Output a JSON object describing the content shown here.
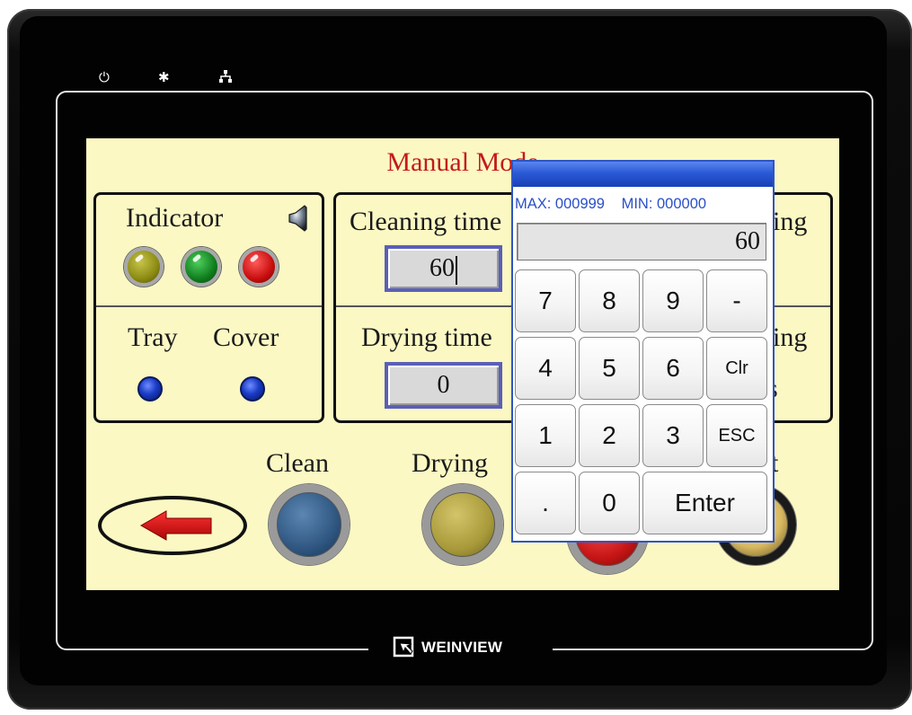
{
  "device": {
    "brand": "WEINVIEW",
    "status_leds": {
      "power_icon": "power-icon",
      "activity_icon": "asterisk-icon",
      "network_icon": "network-icon"
    }
  },
  "screen": {
    "title": "Manual Mode",
    "indicator_panel": {
      "indicator_label": "Indicator",
      "speaker_icon": "speaker-icon",
      "lamps": [
        {
          "name": "yellow",
          "color": "#8b8a12"
        },
        {
          "name": "green",
          "color": "#0f7d1e"
        },
        {
          "name": "red",
          "color": "#c80d0d"
        }
      ],
      "tray_label": "Tray",
      "cover_label": "Cover",
      "tray_lamp_color": "#1a3cc7",
      "cover_lamp_color": "#1a3cc7"
    },
    "settings_panel": {
      "cleaning_label": "Cleaning time",
      "cleaning_value": "60",
      "drying_label": "Drying time",
      "drying_value": "0",
      "right_top_fragment": "ing",
      "right_bottom_fragment": "ing",
      "right_bottom_fragment2": "s"
    },
    "buttons": {
      "back_icon": "left-arrow-icon",
      "clean_label": "Clean",
      "clean_color": "#2e5680",
      "drying_label": "Drying",
      "drying_color": "#a89a3a",
      "third_color": "#c51515",
      "fourth_label_fragment": "t"
    }
  },
  "keypad": {
    "max_label": "MAX: 000999",
    "min_label": "MIN: 000000",
    "display_value": "60",
    "keys": [
      "7",
      "8",
      "9",
      "-",
      "4",
      "5",
      "6",
      "Clr",
      "1",
      "2",
      "3",
      "ESC",
      ".",
      "0",
      "Enter"
    ]
  }
}
